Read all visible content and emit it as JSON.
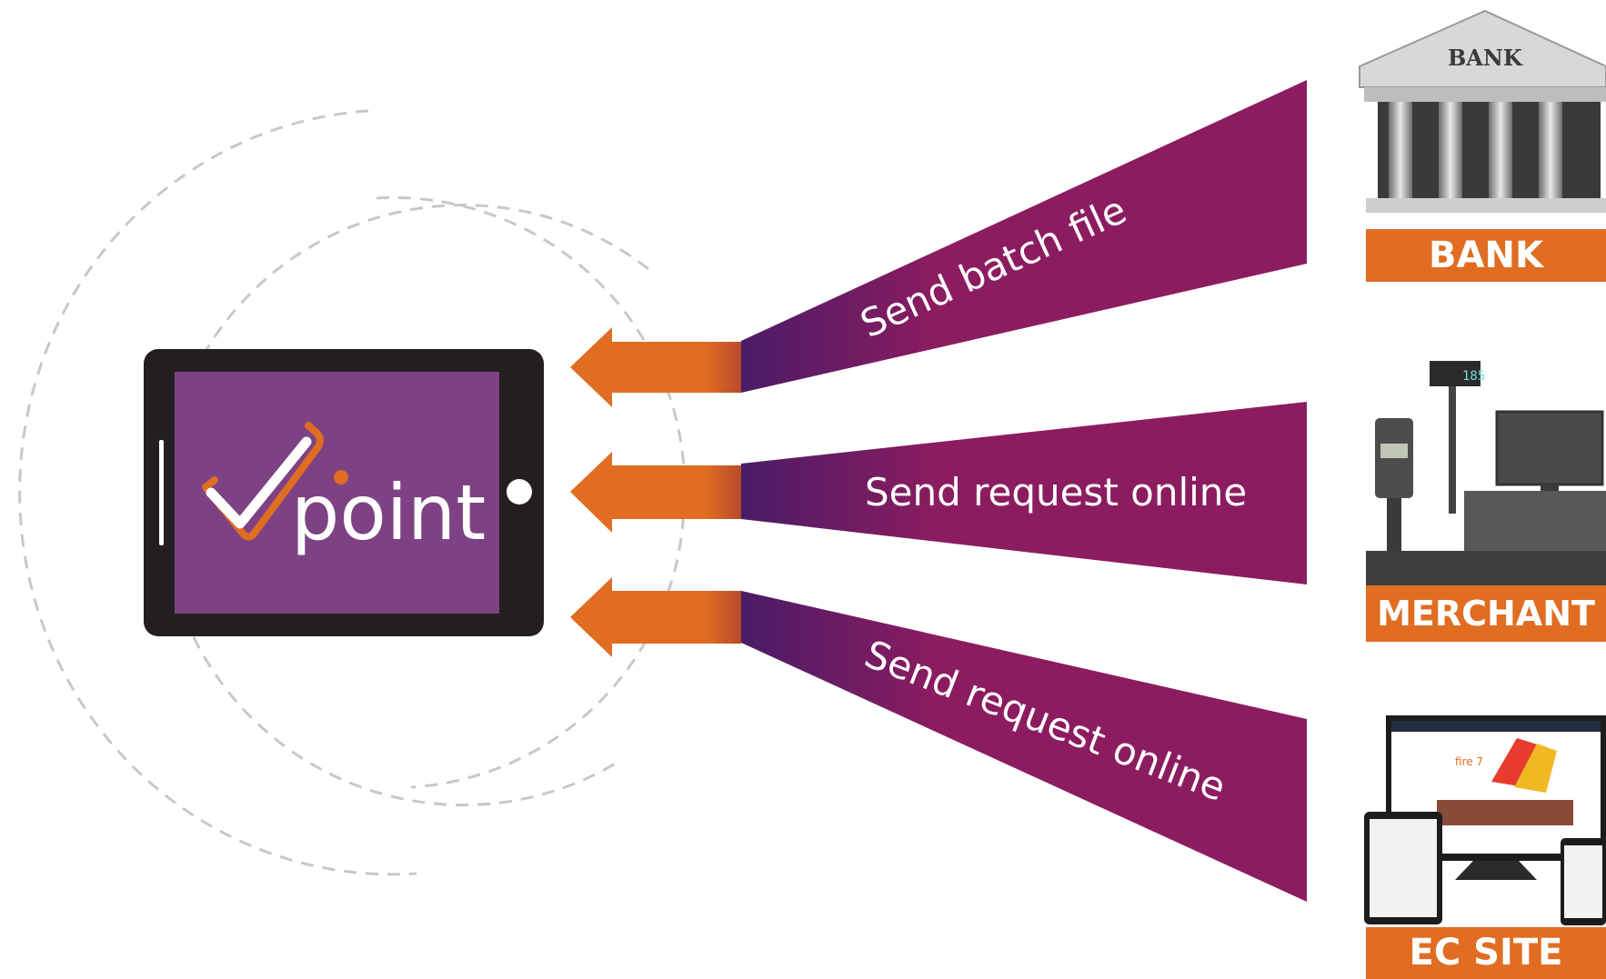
{
  "logo": {
    "text": "point"
  },
  "beams": [
    {
      "label": "Send batch file"
    },
    {
      "label": "Send request online"
    },
    {
      "label": "Send request online"
    }
  ],
  "targets": [
    {
      "label": "BANK",
      "pediment_text": "BANK",
      "icon": "bank-building-icon"
    },
    {
      "label": "MERCHANT",
      "display_text": "185",
      "icon": "pos-terminal-icon"
    },
    {
      "label": "EC SITE",
      "screen_text": "fire 7",
      "icon": "ecommerce-devices-icon"
    }
  ],
  "colors": {
    "purple": "#8c1c60",
    "purple_dark": "#4a1c66",
    "orange": "#e06d22",
    "tablet_screen": "#7e4284",
    "tablet_body": "#231f20"
  }
}
